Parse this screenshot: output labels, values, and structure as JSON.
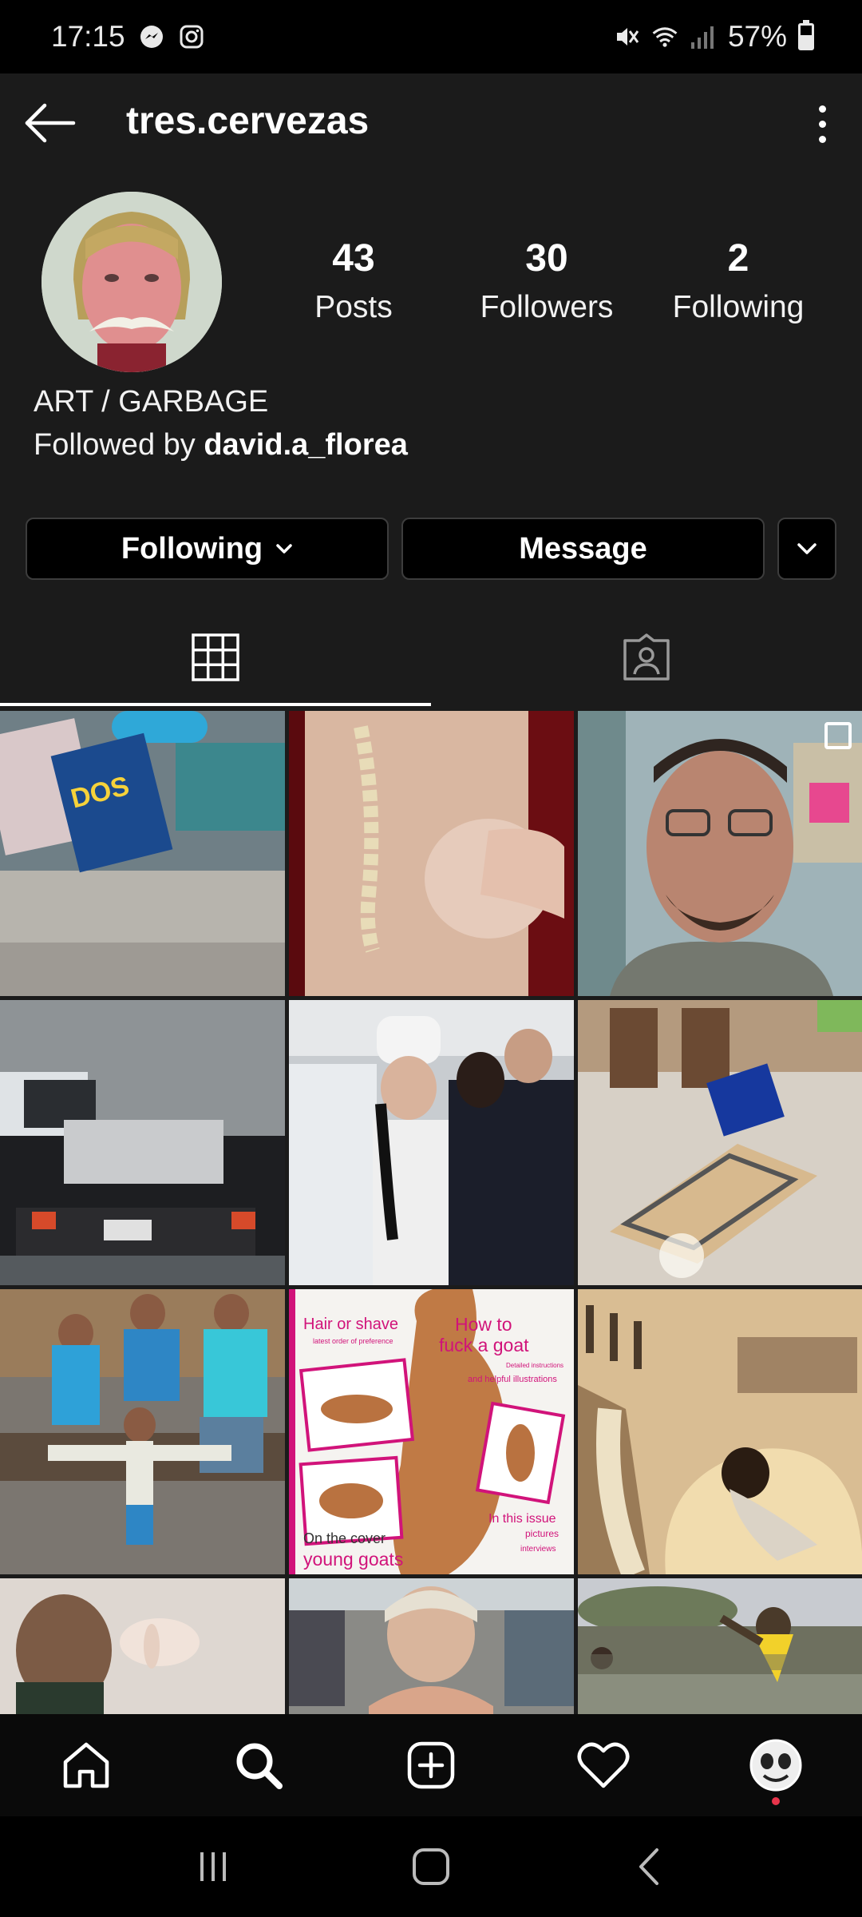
{
  "status_bar": {
    "time": "17:15",
    "battery": "57%",
    "icons": [
      "messenger-icon",
      "instagram-icon",
      "mute-icon",
      "wifi-icon",
      "signal-icon",
      "battery-icon"
    ]
  },
  "header": {
    "username": "tres.cervezas"
  },
  "profile": {
    "stats": [
      {
        "value": "43",
        "label": "Posts"
      },
      {
        "value": "30",
        "label": "Followers"
      },
      {
        "value": "2",
        "label": "Following"
      }
    ],
    "bio": "ART / GARBAGE",
    "followed_by_prefix": "Followed by ",
    "followed_by_user": "david.a_florea"
  },
  "actions": {
    "following_label": "Following",
    "message_label": "Message"
  },
  "tabs": [
    "grid-icon",
    "tagged-icon"
  ],
  "grid": {
    "tile_8": {
      "hair": "Hair or shave",
      "latest": "latest order of preference",
      "how_to": "How to",
      "fuck": "fuck a goat",
      "detailed": "Detailed instructions",
      "helpful": "and helpful illustrations",
      "in_this_issue": "In this issue",
      "pictures": "pictures",
      "interviews": "interviews",
      "on_cover": "On the cover",
      "young_goats": "young goats"
    },
    "tile_1": {
      "box_text": "DOS"
    }
  },
  "bottom_nav": [
    "home-icon",
    "search-icon",
    "new-post-icon",
    "activity-icon",
    "profile-icon"
  ],
  "system_nav": [
    "recents-icon",
    "home-icon",
    "back-icon"
  ]
}
